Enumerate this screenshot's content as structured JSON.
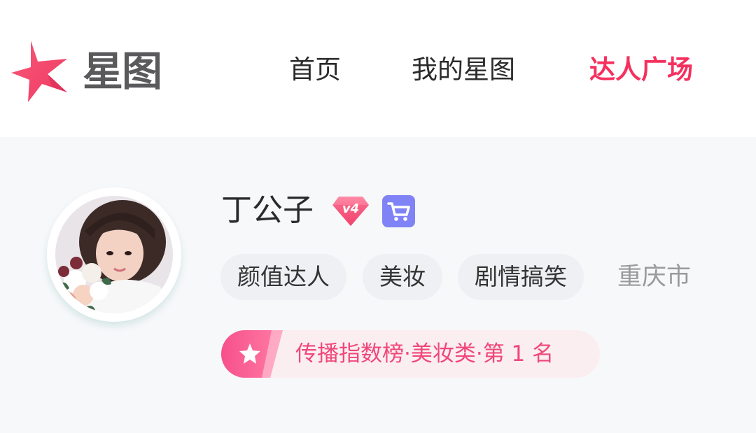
{
  "header": {
    "logo_text": "星图",
    "nav": [
      "首页",
      "我的星图",
      "达人广场"
    ],
    "active_nav": "达人广场",
    "accent_color": "#f5305e"
  },
  "profile": {
    "name": "丁公子",
    "level_badge": "v4",
    "level_icon": "diamond-level-icon",
    "store_icon": "shopping-cart-icon",
    "tags": [
      "颜值达人",
      "美妆",
      "剧情搞笑"
    ],
    "city": "重庆市",
    "ranking": {
      "icon": "star-icon",
      "text": "传播指数榜·美妆类·第 1 名"
    }
  }
}
